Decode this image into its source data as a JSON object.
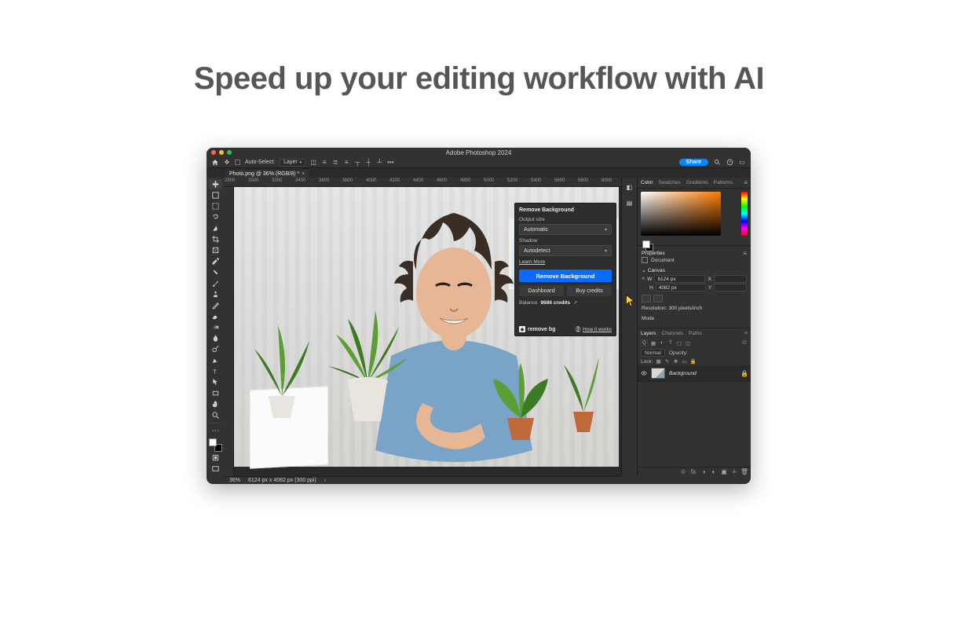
{
  "hero": {
    "title": "Speed up your editing workflow with AI"
  },
  "titlebar": {
    "title": "Adobe Photoshop 2024"
  },
  "optbar": {
    "auto_select": "Auto-Select:",
    "layer": "Layer",
    "share": "Share",
    "align_icons": [
      "align-left",
      "align-h-center",
      "align-right",
      "align-top",
      "align-v-center",
      "align-bottom"
    ],
    "more": "•••"
  },
  "doc_tab": {
    "label": "Photo.png @ 36% (RGB/8) *"
  },
  "ruler_ticks": [
    "2800",
    "3000",
    "3200",
    "3400",
    "3600",
    "3800",
    "4000",
    "4200",
    "4400",
    "4600",
    "4800",
    "5000",
    "5200",
    "5400",
    "5600",
    "5800",
    "6000"
  ],
  "tools": [
    "move",
    "artboard",
    "marquee",
    "lasso",
    "quick-select",
    "crop",
    "frame",
    "eyedropper",
    "heal",
    "brush",
    "clone",
    "history-brush",
    "eraser",
    "gradient",
    "blur",
    "dodge",
    "pen",
    "type",
    "path-select",
    "rectangle",
    "hand",
    "zoom"
  ],
  "plugin": {
    "title": "Remove Background",
    "output_label": "Output size",
    "output_value": "Automatic",
    "shadow_label": "Shadow",
    "shadow_value": "Autodetect",
    "learn_more": "Learn More",
    "primary": "Remove Background",
    "dashboard": "Dashboard",
    "buy": "Buy credits",
    "balance_label": "Balance",
    "balance_value": "9686 credits",
    "brand": "remove bg",
    "how": "How it works"
  },
  "panels": {
    "color": {
      "tabs": [
        "Color",
        "Swatches",
        "Gradients",
        "Patterns"
      ]
    },
    "properties": {
      "tab": "Properties",
      "document": "Document",
      "canvas": "Canvas",
      "w_label": "W",
      "w_value": "6124 px",
      "h_label": "H",
      "h_value": "4082 px",
      "x_label": "X",
      "y_label": "Y",
      "resolution": "Resolution: 300 pixels/inch",
      "mode": "Mode"
    },
    "layers": {
      "tabs": [
        "Layers",
        "Channels",
        "Paths"
      ],
      "kind": "Q Kind",
      "blend": "Normal",
      "opacity_label": "Opacity:",
      "lock_label": "Lock:",
      "layer_name": "Background"
    }
  },
  "status": {
    "zoom": "36%",
    "dims": "6124 px x 4082 px (300 ppi)"
  }
}
